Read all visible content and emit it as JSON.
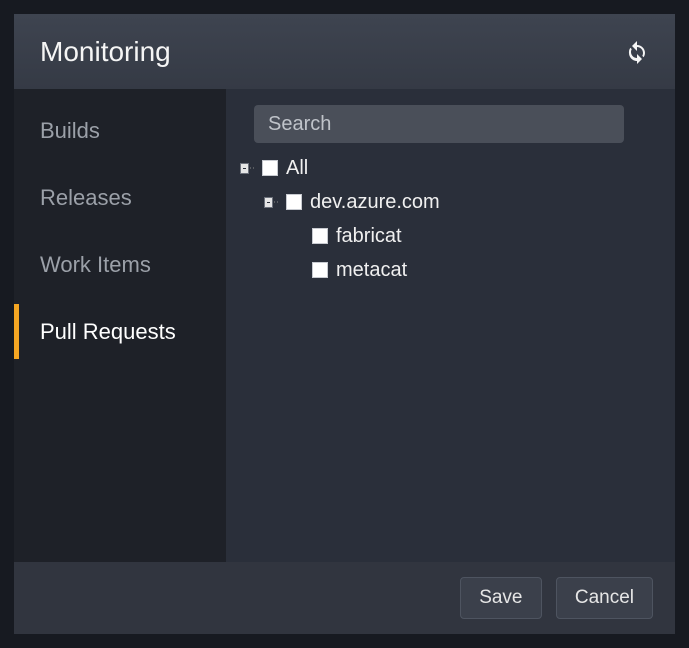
{
  "header": {
    "title": "Monitoring"
  },
  "sidebar": {
    "items": [
      {
        "id": "builds",
        "label": "Builds",
        "selected": false
      },
      {
        "id": "releases",
        "label": "Releases",
        "selected": false
      },
      {
        "id": "workitems",
        "label": "Work Items",
        "selected": false
      },
      {
        "id": "pullrequests",
        "label": "Pull Requests",
        "selected": true
      }
    ]
  },
  "search": {
    "placeholder": "Search",
    "value": ""
  },
  "tree": {
    "root": {
      "label": "All",
      "children": [
        {
          "label": "dev.azure.com",
          "children": [
            {
              "label": "fabricat"
            },
            {
              "label": "metacat"
            }
          ]
        }
      ]
    }
  },
  "footer": {
    "save_label": "Save",
    "cancel_label": "Cancel"
  }
}
